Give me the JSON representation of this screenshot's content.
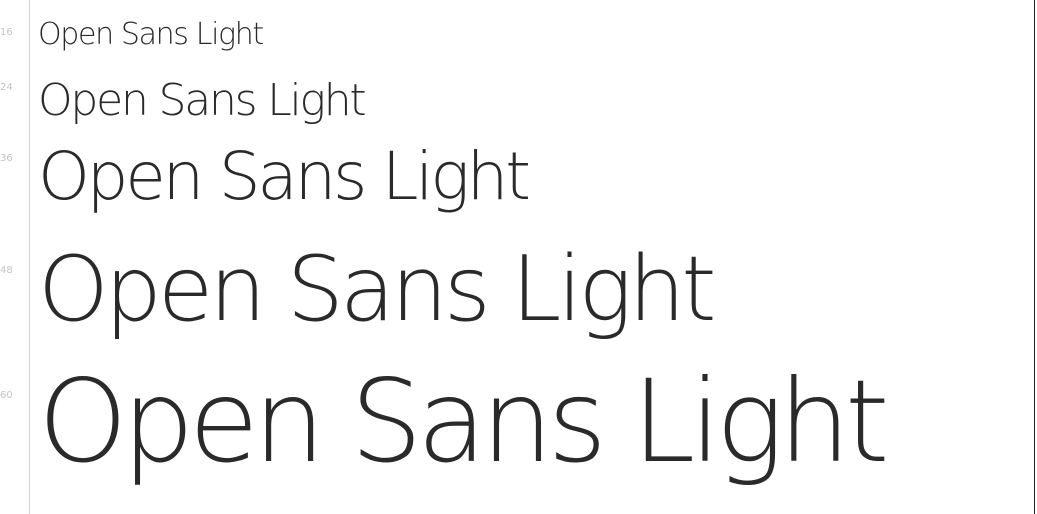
{
  "specimens": [
    {
      "size_label": "16",
      "text": "Open Sans Light"
    },
    {
      "size_label": "24",
      "text": "Open Sans Light"
    },
    {
      "size_label": "36",
      "text": "Open Sans Light"
    },
    {
      "size_label": "48",
      "text": "Open Sans Light"
    },
    {
      "size_label": "60",
      "text": "Open Sans Light"
    }
  ],
  "colors": {
    "text": "#2a2a2a",
    "label": "#c4c4c4",
    "gutter": "#d2d2d2"
  }
}
